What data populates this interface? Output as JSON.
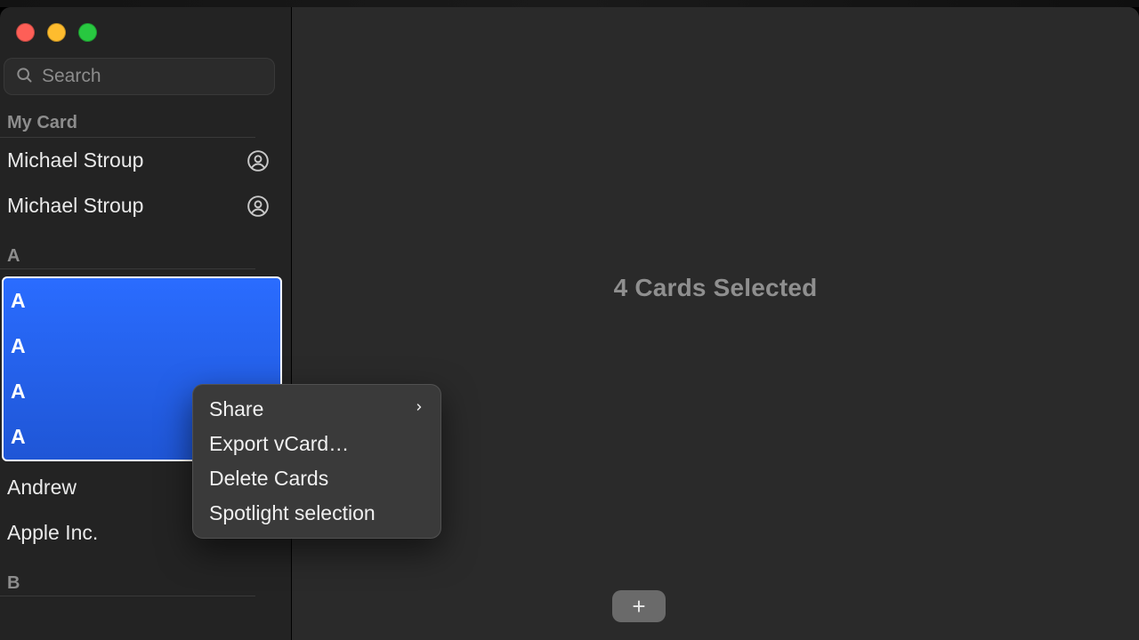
{
  "search": {
    "placeholder": "Search"
  },
  "sections": {
    "my_card": {
      "title": "My Card"
    },
    "a": {
      "title": "A"
    },
    "b": {
      "title": "B"
    }
  },
  "my_card_items": [
    {
      "name": "Michael Stroup"
    },
    {
      "name": "Michael Stroup"
    }
  ],
  "a_selected": [
    {
      "label": "A"
    },
    {
      "label": "A"
    },
    {
      "label": "A"
    },
    {
      "label": "A"
    }
  ],
  "a_items": [
    {
      "name": "Andrew"
    },
    {
      "name": "Apple Inc."
    }
  ],
  "detail": {
    "status": "4 Cards Selected",
    "add_label": "+"
  },
  "context_menu": {
    "items": [
      {
        "label": "Share",
        "has_submenu": true
      },
      {
        "label": "Export vCard…",
        "has_submenu": false
      },
      {
        "label": "Delete Cards",
        "has_submenu": false
      },
      {
        "label": "Spotlight selection",
        "has_submenu": false
      }
    ]
  },
  "icons": {
    "search": "search-icon",
    "person_circle": "person-circle-icon",
    "chevron_right": "chevron-right-icon",
    "plus": "plus-icon"
  }
}
